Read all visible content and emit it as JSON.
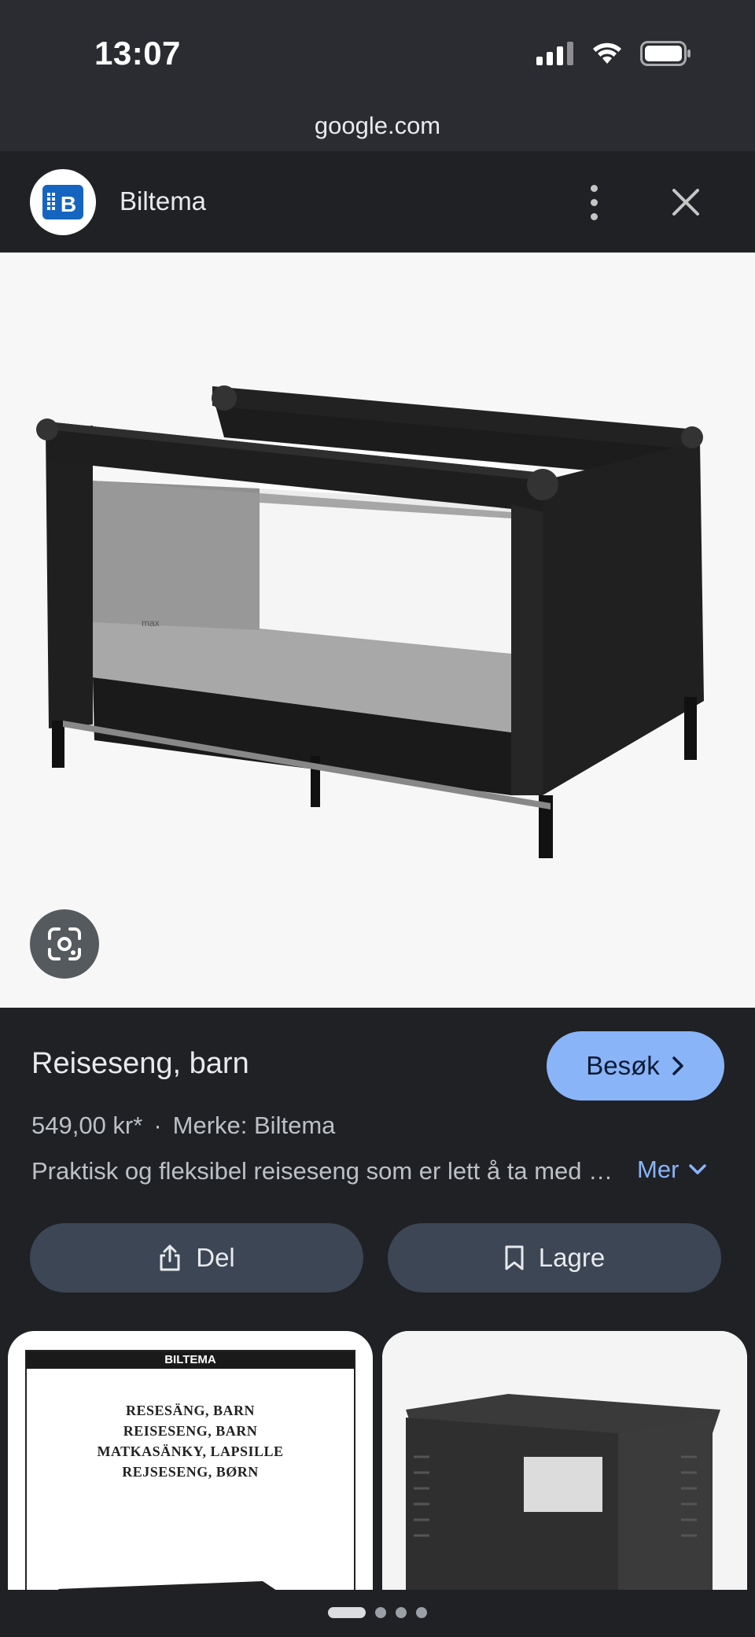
{
  "status_bar": {
    "time": "13:07",
    "icons": [
      "cellular-signal-icon",
      "wifi-icon",
      "battery-icon"
    ]
  },
  "browser": {
    "url": "google.com"
  },
  "site": {
    "name": "Biltema",
    "logo_letter": "B",
    "logo_color": "#1565c0",
    "menu_icon": "more-vertical-icon",
    "close_icon": "close-icon"
  },
  "product": {
    "image_description_icon": "travel-cot-image",
    "lens_icon": "google-lens-icon",
    "title": "Reiseseng, barn",
    "visit_label": "Besøk",
    "price": "549,00 kr*",
    "separator": "·",
    "brand": "Merke: Biltema",
    "description": "Praktisk og fleksibel reiseseng som er lett å ta med seg",
    "more_label": "Mer"
  },
  "actions": {
    "share_label": "Del",
    "save_label": "Lagre"
  },
  "related": {
    "card1": {
      "header": "BILTEMA",
      "lines": [
        "RESESÄNG, BARN",
        "REISESENG, BARN",
        "MATKASÄNKY, LAPSILLE",
        "REJSESENG, BØRN"
      ]
    }
  },
  "colors": {
    "accent": "#8ab4f8",
    "background": "#1f2125",
    "button_bg": "#3c4655"
  },
  "pager": {
    "count": 4,
    "active": 1
  }
}
